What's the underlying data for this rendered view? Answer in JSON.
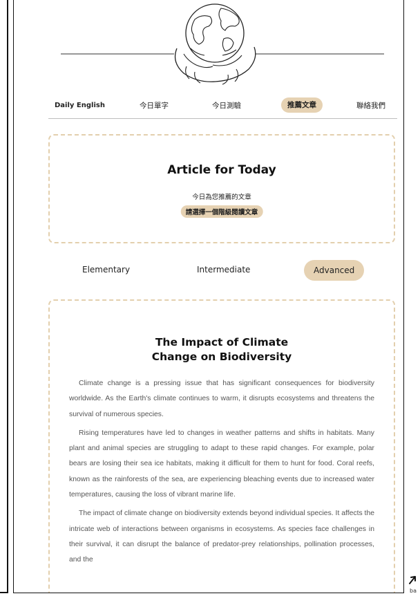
{
  "nav": {
    "brand": "Daily English",
    "items": [
      {
        "label": "今日單字",
        "active": false
      },
      {
        "label": "今日測驗",
        "active": false
      },
      {
        "label": "推薦文章",
        "active": true
      },
      {
        "label": "聯絡我們",
        "active": false
      }
    ]
  },
  "article_header": {
    "title": "Article for Today",
    "subtitle": "今日為您推薦的文章",
    "prompt": "請選擇一個階級閱讀文章"
  },
  "levels": {
    "elementary": "Elementary",
    "intermediate": "Intermediate",
    "advanced": "Advanced",
    "selected": "Advanced"
  },
  "article": {
    "title_line1": "The Impact of Climate",
    "title_line2": "Change on Biodiversity",
    "paragraphs": [
      "Climate change is a pressing issue that has significant consequences for biodiversity worldwide. As the Earth's climate continues to warm, it disrupts ecosystems and threatens the survival of numerous species.",
      "Rising temperatures have led to changes in weather patterns and shifts in habitats. Many plant and animal species are struggling to adapt to these rapid changes. For example, polar bears are losing their sea ice habitats, making it difficult for them to hunt for food. Coral reefs, known as the rainforests of the sea, are experiencing bleaching events due to increased water temperatures, causing the loss of vibrant marine life.",
      "The impact of climate change on biodiversity extends beyond individual species. It affects the intricate web of interactions between organisms in ecosystems. As species face challenges in their survival, it can disrupt the balance of predator-prey relationships, pollination processes, and the"
    ]
  },
  "back_to_top": {
    "label": "ba",
    "icon": "arrow-up-icon"
  },
  "colors": {
    "accent": "#e6d2b3",
    "dashed_border": "#e3cfad",
    "text": "#222222",
    "body_text": "#555555"
  }
}
